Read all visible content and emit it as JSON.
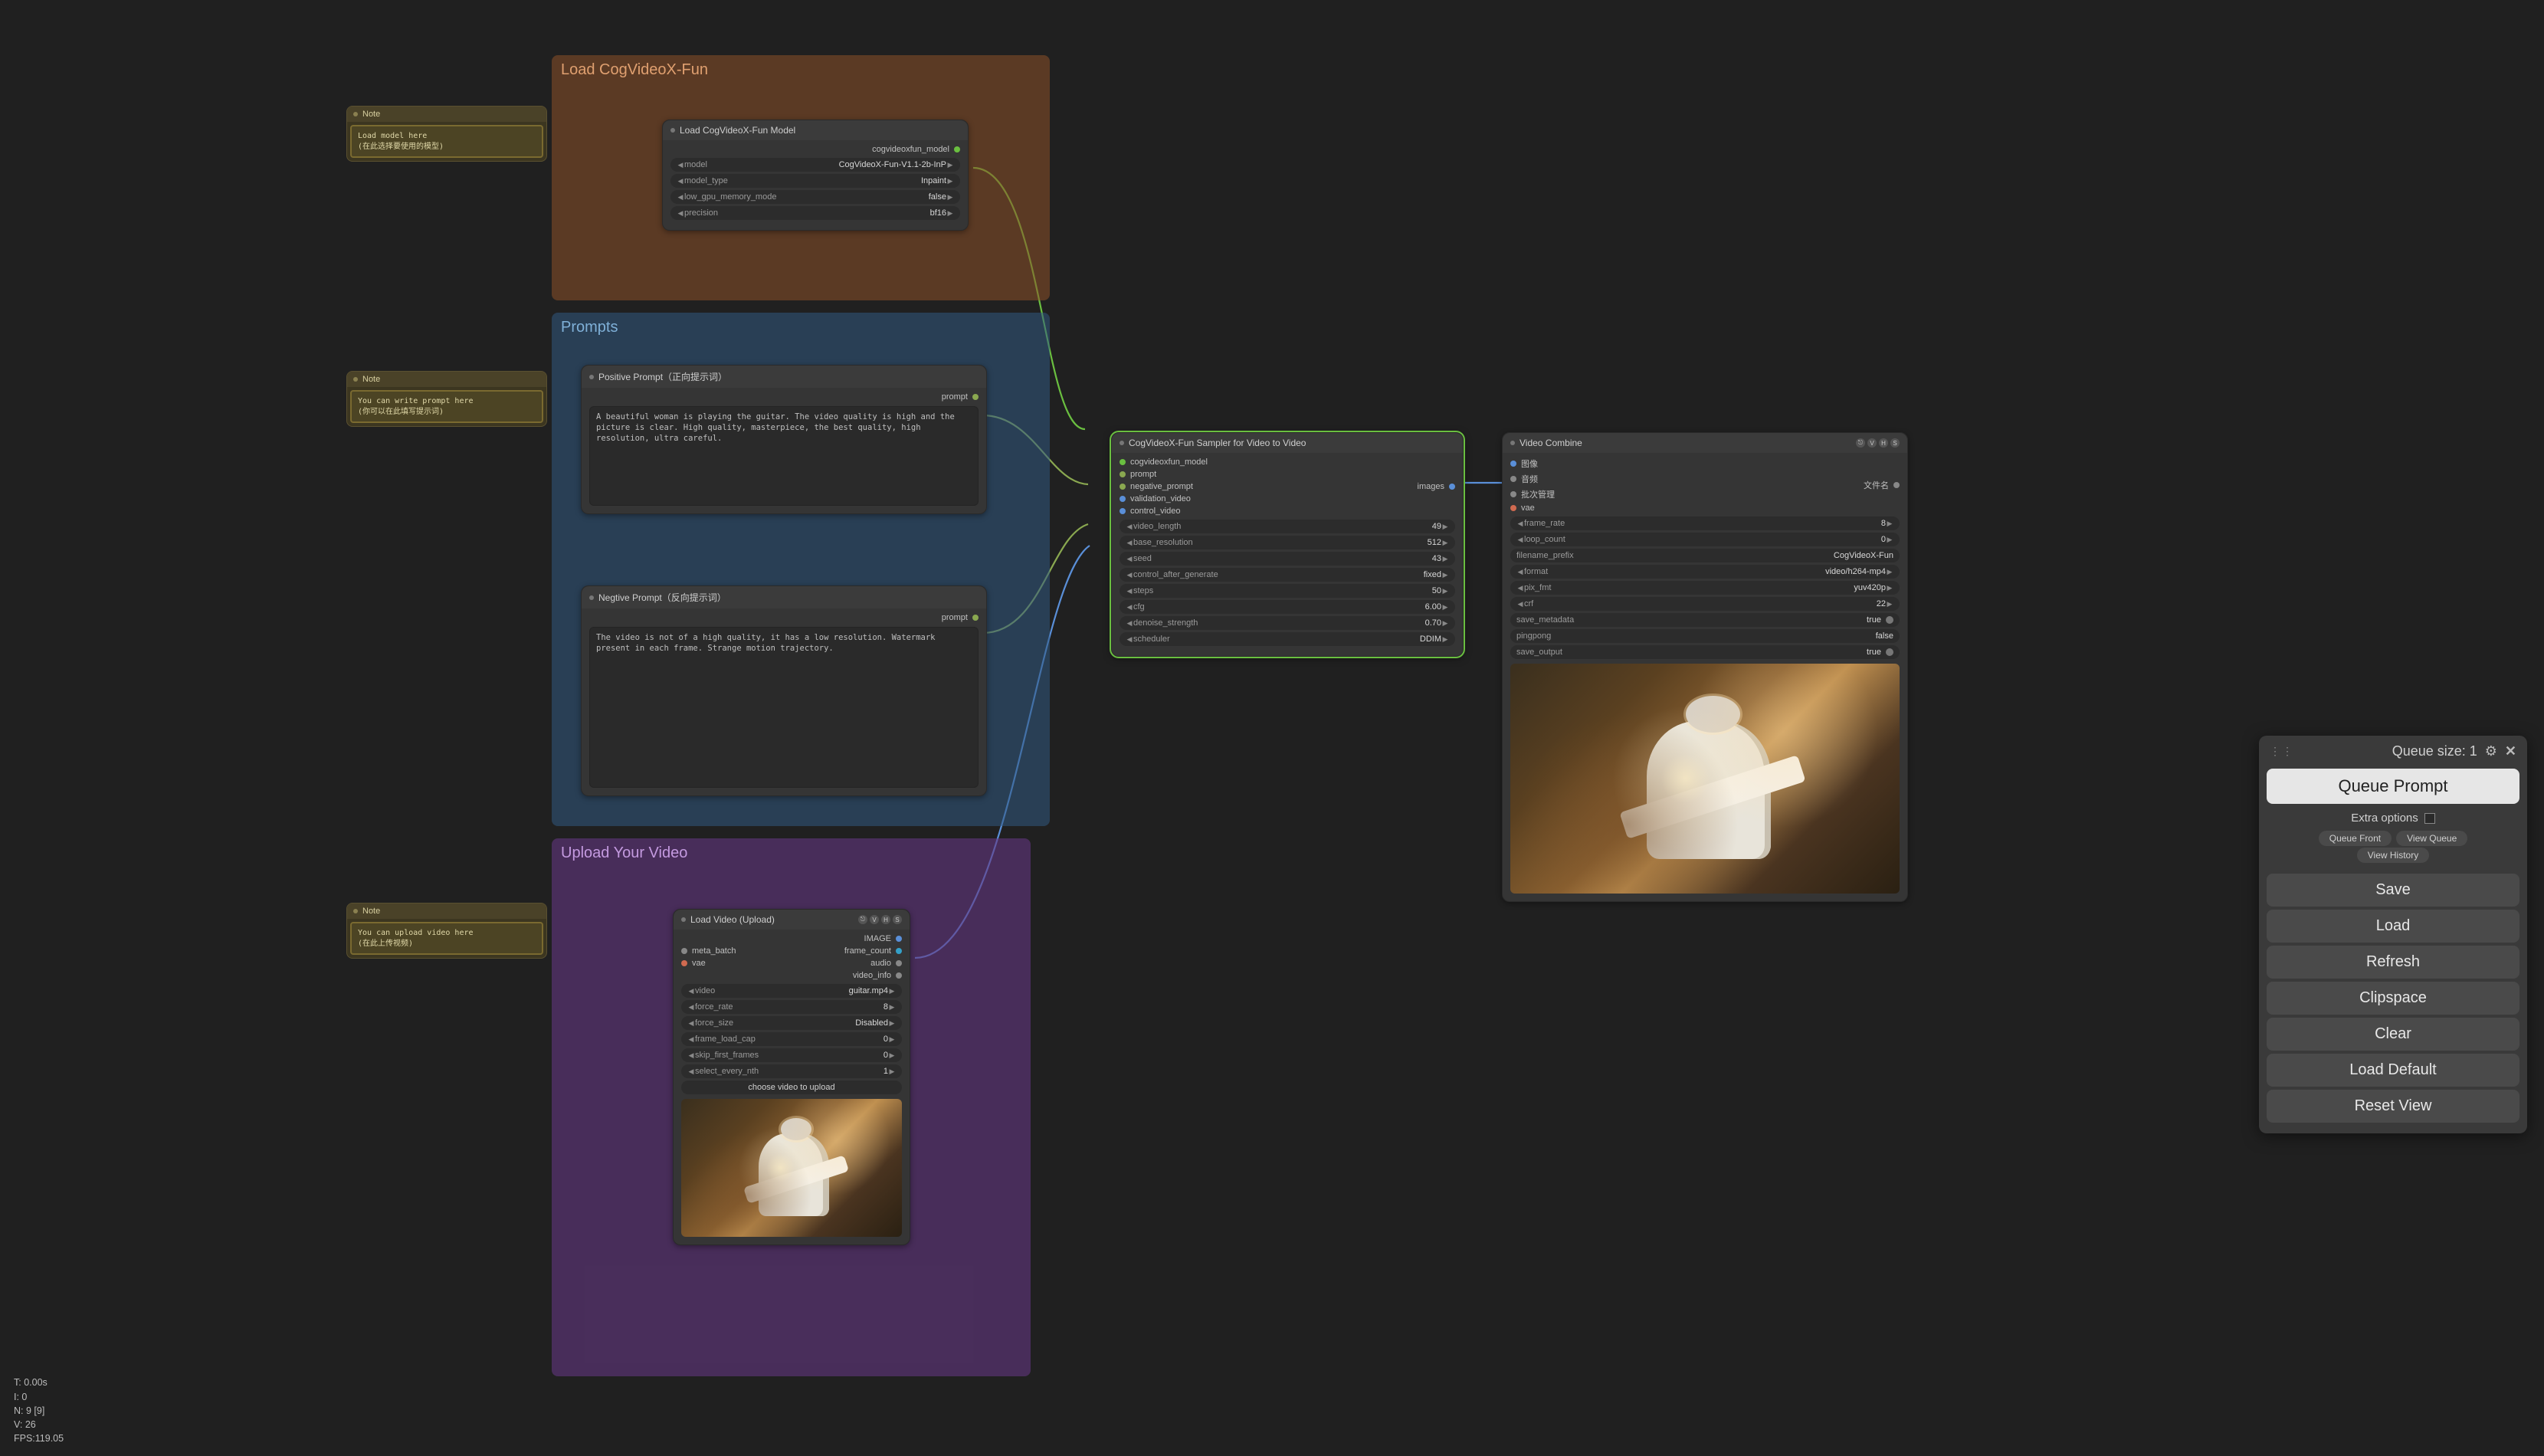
{
  "groups": {
    "load": {
      "title": "Load CogVideoX-Fun"
    },
    "prompts": {
      "title": "Prompts"
    },
    "upload": {
      "title": "Upload Your Video"
    }
  },
  "notes": {
    "n1": {
      "title": "Note",
      "body": "Load model here\n(在此选择要使用的模型)"
    },
    "n2": {
      "title": "Note",
      "body": "You can write prompt here\n(你可以在此填写提示词)"
    },
    "n3": {
      "title": "Note",
      "body": "You can upload video here\n(在此上传视频)"
    }
  },
  "load_model": {
    "title": "Load CogVideoX-Fun Model",
    "out": "cogvideoxfun_model",
    "widgets": {
      "model": {
        "label": "model",
        "value": "CogVideoX-Fun-V1.1-2b-InP"
      },
      "mtype": {
        "label": "model_type",
        "value": "Inpaint"
      },
      "lowmem": {
        "label": "low_gpu_memory_mode",
        "value": "false"
      },
      "prec": {
        "label": "precision",
        "value": "bf16"
      }
    }
  },
  "pos_prompt": {
    "title": "Positive Prompt（正向提示词）",
    "out": "prompt",
    "text": "A beautiful woman is playing the guitar. The video quality is high and the picture is clear. High quality, masterpiece, the best quality, high resolution, ultra careful."
  },
  "neg_prompt": {
    "title": "Negtive Prompt（反向提示词）",
    "out": "prompt",
    "text": "The video is not of a high quality, it has a low resolution. Watermark present in each frame. Strange motion trajectory."
  },
  "sampler": {
    "title": "CogVideoX-Fun Sampler for Video to Video",
    "inputs": [
      "cogvideoxfun_model",
      "prompt",
      "negative_prompt",
      "validation_video",
      "control_video"
    ],
    "out": "images",
    "widgets": {
      "video_length": {
        "label": "video_length",
        "value": "49"
      },
      "base_resolution": {
        "label": "base_resolution",
        "value": "512"
      },
      "seed": {
        "label": "seed",
        "value": "43"
      },
      "control_after_generate": {
        "label": "control_after_generate",
        "value": "fixed"
      },
      "steps": {
        "label": "steps",
        "value": "50"
      },
      "cfg": {
        "label": "cfg",
        "value": "6.00"
      },
      "denoise_strength": {
        "label": "denoise_strength",
        "value": "0.70"
      },
      "scheduler": {
        "label": "scheduler",
        "value": "DDIM"
      }
    }
  },
  "load_video": {
    "title": "Load Video (Upload)",
    "inputs": [
      "meta_batch",
      "vae"
    ],
    "outputs": [
      "IMAGE",
      "frame_count",
      "audio",
      "video_info"
    ],
    "widgets": {
      "video": {
        "label": "video",
        "value": "guitar.mp4"
      },
      "force_rate": {
        "label": "force_rate",
        "value": "8"
      },
      "force_size": {
        "label": "force_size",
        "value": "Disabled"
      },
      "frame_load_cap": {
        "label": "frame_load_cap",
        "value": "0"
      },
      "skip_first_frames": {
        "label": "skip_first_frames",
        "value": "0"
      },
      "select_every_nth": {
        "label": "select_every_nth",
        "value": "1"
      }
    },
    "upload_btn": "choose video to upload"
  },
  "video_combine": {
    "title": "Video Combine",
    "inputs": [
      "图像",
      "音频",
      "批次管理",
      "vae"
    ],
    "out": "文件名",
    "widgets": {
      "frame_rate": {
        "label": "frame_rate",
        "value": "8"
      },
      "loop_count": {
        "label": "loop_count",
        "value": "0"
      },
      "filename_prefix": {
        "label": "filename_prefix",
        "value": "CogVideoX-Fun"
      },
      "format": {
        "label": "format",
        "value": "video/h264-mp4"
      },
      "pix_fmt": {
        "label": "pix_fmt",
        "value": "yuv420p"
      },
      "crf": {
        "label": "crf",
        "value": "22"
      },
      "save_metadata": {
        "label": "save_metadata",
        "value": "true"
      },
      "pingpong": {
        "label": "pingpong",
        "value": "false"
      },
      "save_output": {
        "label": "save_output",
        "value": "true"
      }
    }
  },
  "panel": {
    "queue_size_label": "Queue size: 1",
    "queue_prompt": "Queue Prompt",
    "extra_options": "Extra options",
    "queue_front": "Queue Front",
    "view_queue": "View Queue",
    "view_history": "View History",
    "save": "Save",
    "load": "Load",
    "refresh": "Refresh",
    "clipspace": "Clipspace",
    "clear": "Clear",
    "load_default": "Load Default",
    "reset_view": "Reset View"
  },
  "stats": {
    "l1": "T: 0.00s",
    "l2": "I: 0",
    "l3": "N: 9 [9]",
    "l4": "V: 26",
    "l5": "FPS:119.05"
  }
}
